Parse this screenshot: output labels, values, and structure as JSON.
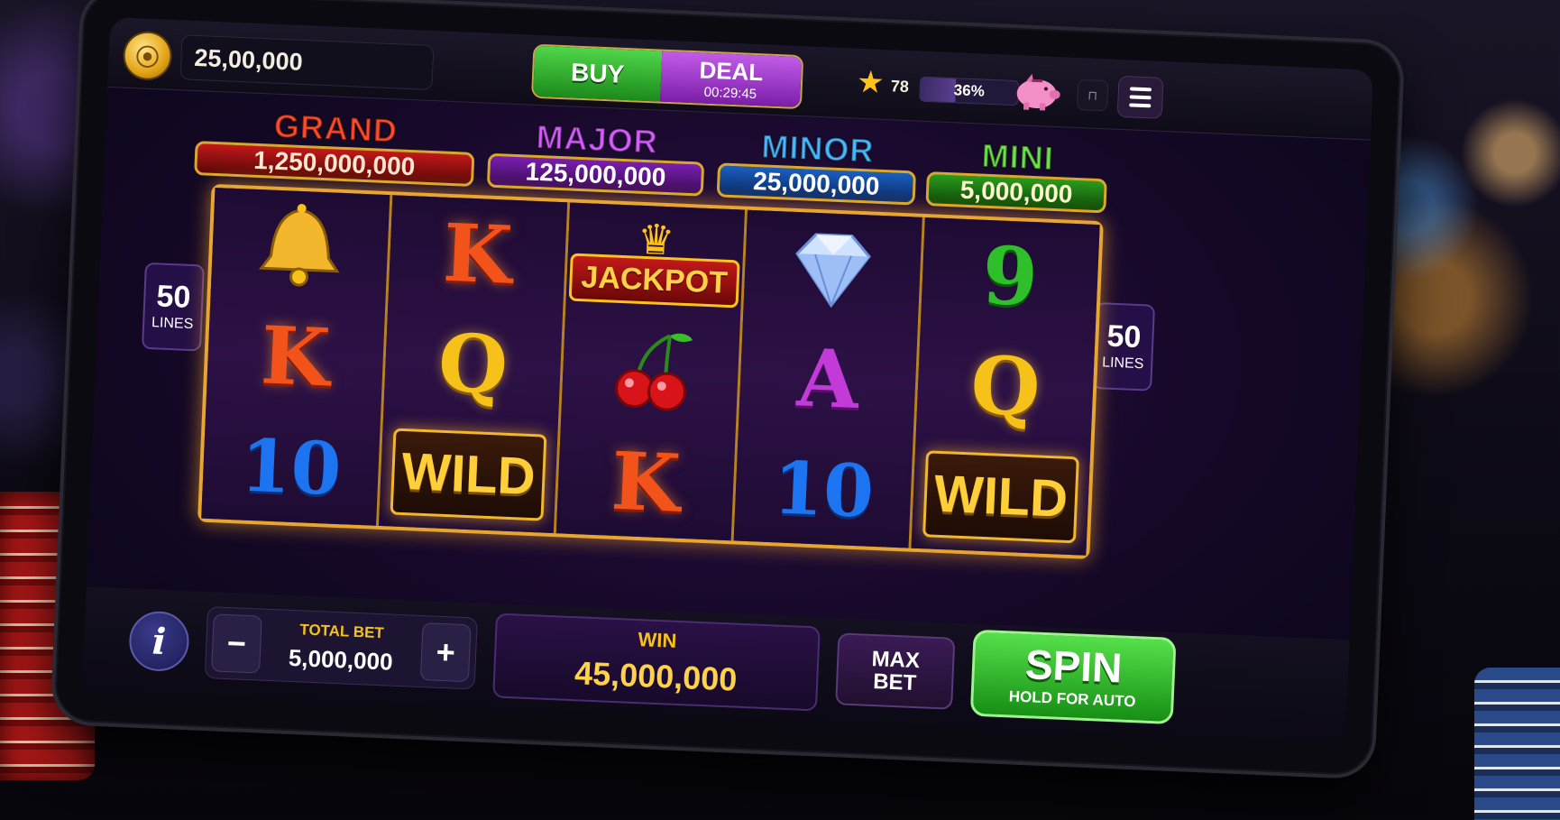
{
  "topbar": {
    "balance": "25,00,000",
    "buy_label": "BUY",
    "deal_label": "DEAL",
    "deal_timer": "00:29:45",
    "stars": "78",
    "progress_text": "36%",
    "progress_value": 0.36
  },
  "jackpots": {
    "grand": {
      "title": "GRAND",
      "value": "1,250,000,000"
    },
    "major": {
      "title": "MAJOR",
      "value": "125,000,000"
    },
    "minor": {
      "title": "MINOR",
      "value": "25,000,000"
    },
    "mini": {
      "title": "MINI",
      "value": "5,000,000"
    }
  },
  "lines": {
    "count": "50",
    "label": "LINES"
  },
  "reels": [
    [
      "bell",
      "K",
      "10"
    ],
    [
      "K",
      "Q",
      "WILD"
    ],
    [
      "JACKPOT",
      "cherries",
      "K"
    ],
    [
      "diamond",
      "A",
      "10"
    ],
    [
      "9",
      "Q",
      "WILD"
    ]
  ],
  "symbols": {
    "wild": "WILD",
    "jackpot": "JACKPOT"
  },
  "bottom": {
    "info": "i",
    "total_bet_label": "TOTAL BET",
    "total_bet_value": "5,000,000",
    "minus": "−",
    "plus": "+",
    "win_label": "WIN",
    "win_value": "45,000,000",
    "max_label": "MAX",
    "bet_label": "BET",
    "spin_label": "SPIN",
    "spin_sub": "HOLD FOR AUTO"
  },
  "colors": {
    "accent_gold": "#e7a531",
    "spin_green": "#2fbf2a",
    "deal_purple": "#9a2ecf"
  },
  "icons": {
    "coin": "coin-icon",
    "star": "star-icon",
    "piggy": "piggy-bank-icon",
    "menu": "hamburger-menu-icon",
    "crown": "crown-icon",
    "bell": "bell-icon",
    "diamond": "diamond-icon",
    "cherries": "cherries-icon"
  }
}
